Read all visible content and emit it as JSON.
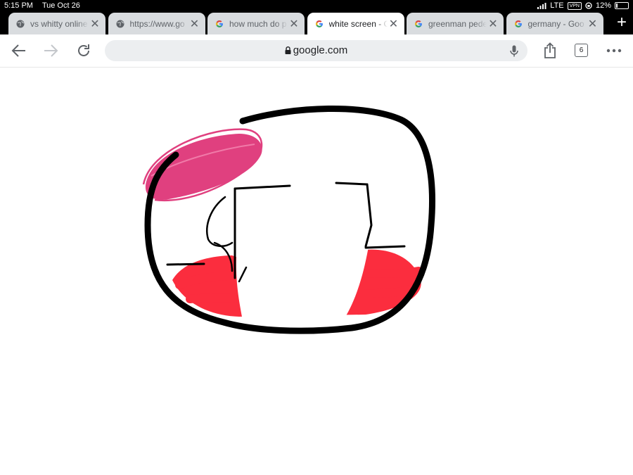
{
  "status_bar": {
    "time": "5:15 PM",
    "date": "Tue Oct 26",
    "network": "LTE",
    "vpn": "VPN",
    "battery": "12%"
  },
  "tabs": [
    {
      "title": "vs whitty online",
      "icon": "globe-icon",
      "active": false
    },
    {
      "title": "https://www.go",
      "icon": "globe-icon",
      "active": false
    },
    {
      "title": "how much do p",
      "icon": "google-icon",
      "active": false
    },
    {
      "title": "white screen - G",
      "icon": "google-icon",
      "active": true
    },
    {
      "title": "greenman pede",
      "icon": "google-icon",
      "active": false
    },
    {
      "title": "germany - Goo",
      "icon": "google-icon",
      "active": false
    }
  ],
  "toolbar": {
    "url": "google.com",
    "tab_count": "6"
  },
  "colors": {
    "chrome_bg": "#000000",
    "tab_inactive": "#d9dcdf",
    "omnibox": "#eceef0",
    "drawing_pink": "#e0407f",
    "drawing_red": "#fb2d3e"
  }
}
